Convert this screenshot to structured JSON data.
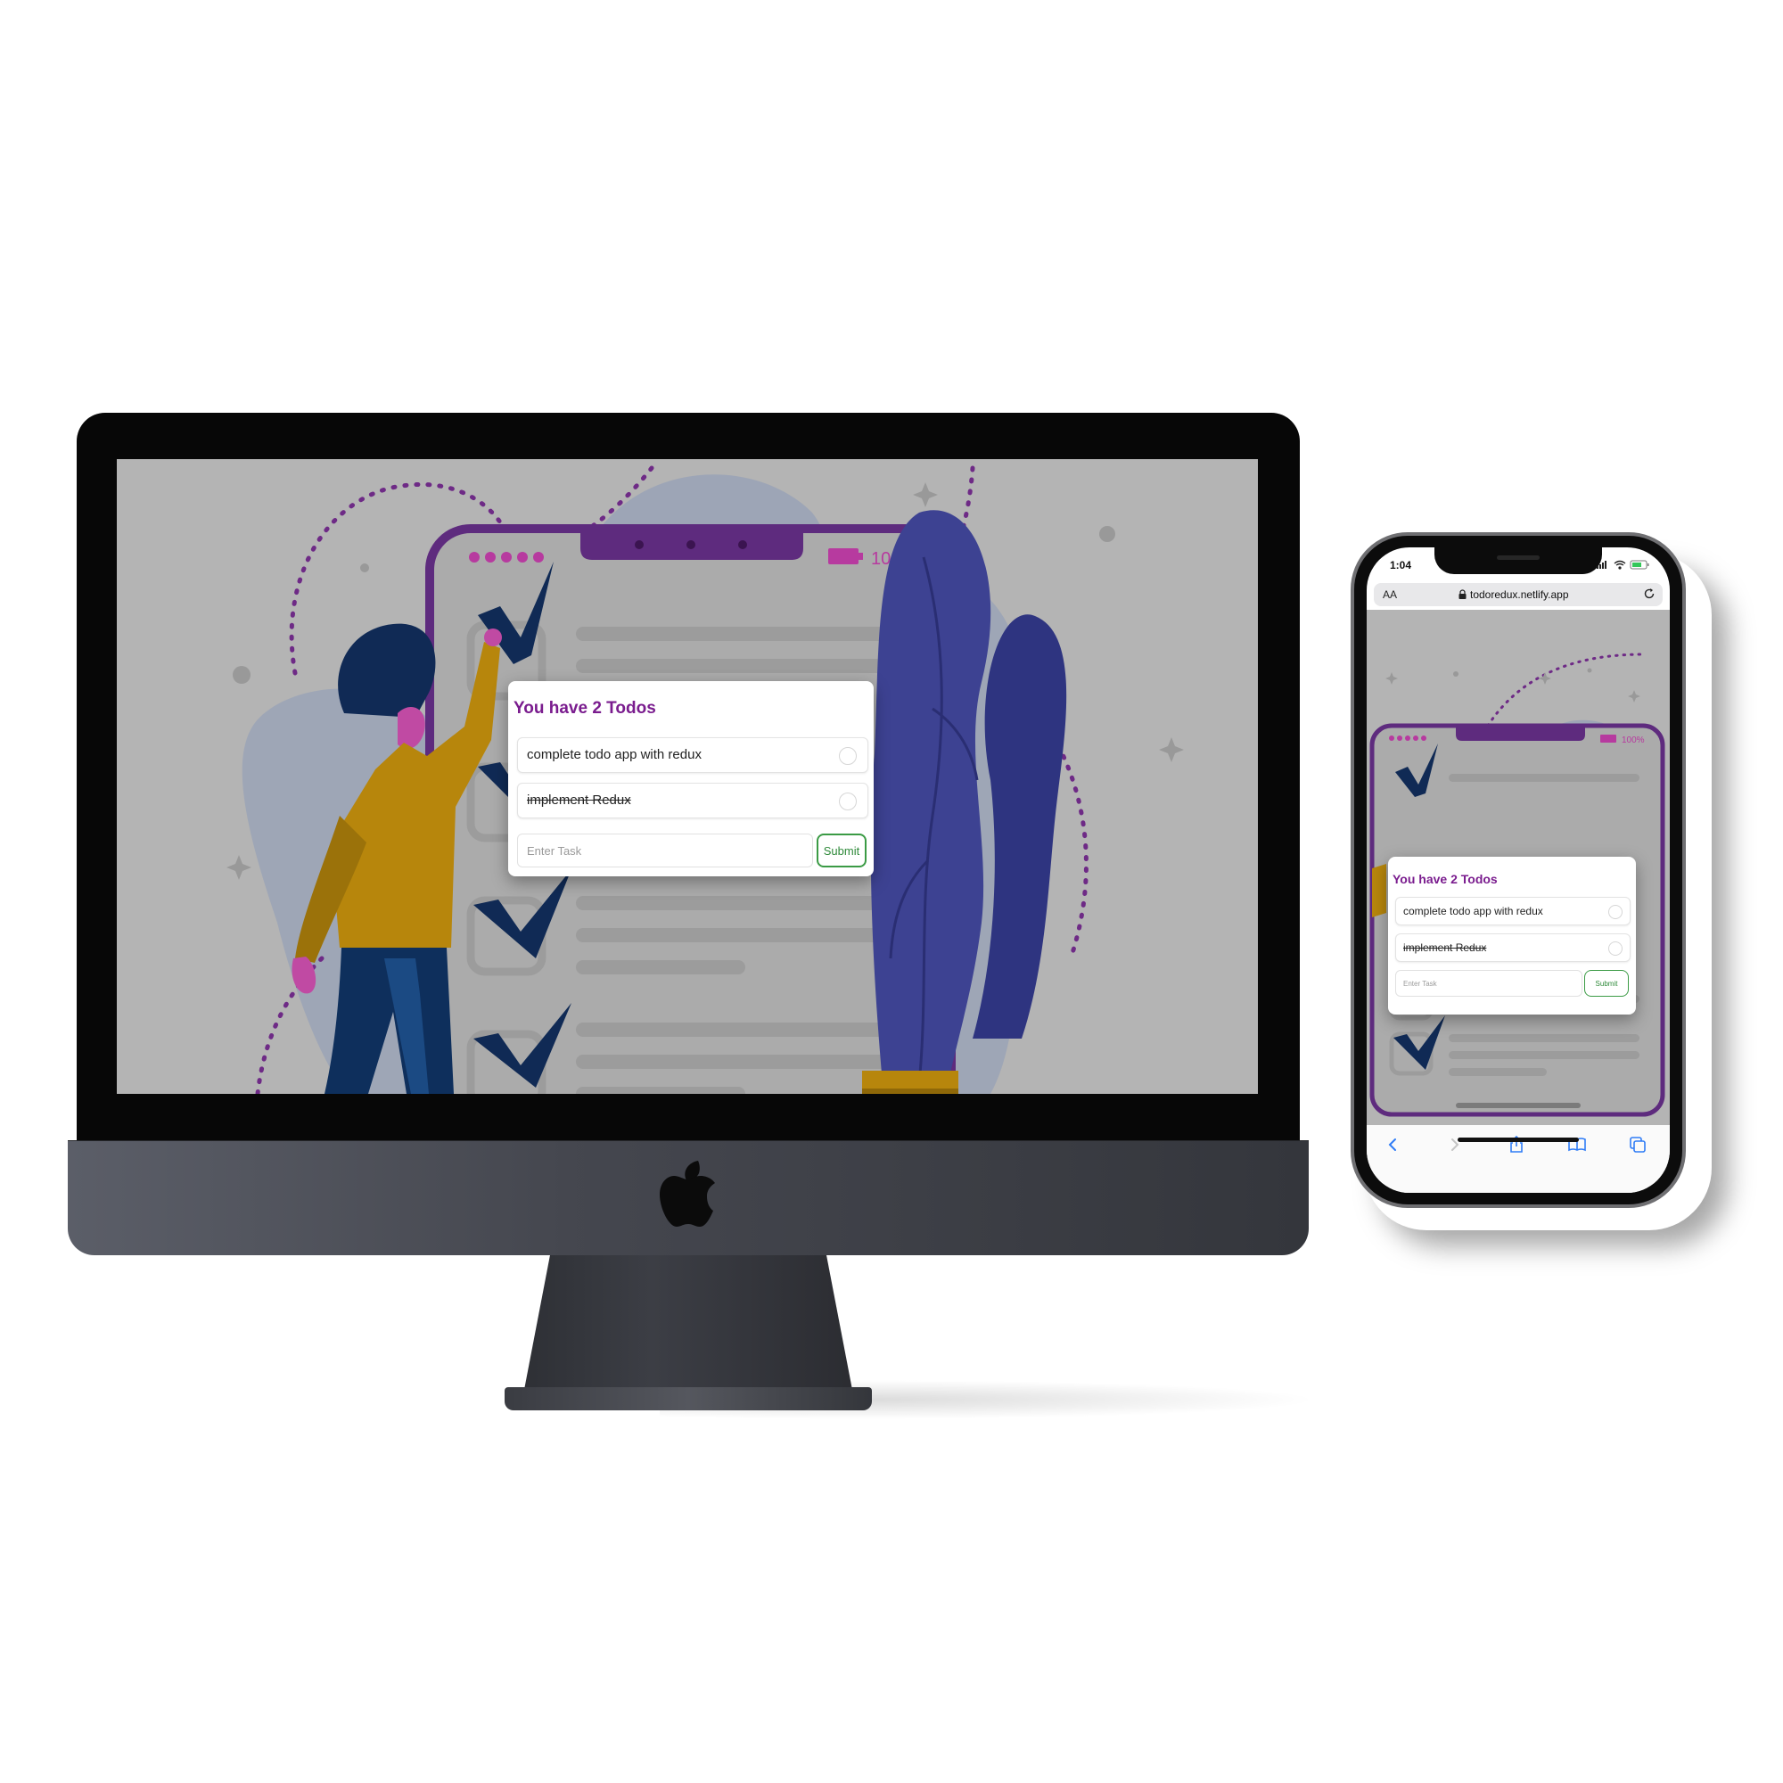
{
  "todo_app": {
    "title": "You have 2 Todos",
    "todos": [
      {
        "text": "complete todo app with redux",
        "completed": false
      },
      {
        "text": "implement Redux",
        "completed": true
      }
    ],
    "input": {
      "placeholder": "Enter Task",
      "value": ""
    },
    "submit_label": "Submit"
  },
  "illustration": {
    "battery_label": "100%"
  },
  "phone": {
    "status_time": "1:04",
    "url_aa": "AA",
    "url": "todoredux.netlify.app"
  },
  "icons": {
    "desktop": "apple-logo-icon",
    "url_bar": [
      "lock-icon",
      "reload-icon"
    ],
    "status": [
      "signal-icon",
      "wifi-icon",
      "battery-icon"
    ],
    "toolbar": [
      "back-icon",
      "forward-icon",
      "share-icon",
      "bookmarks-icon",
      "tabs-icon"
    ]
  },
  "colors": {
    "title": "#7a1c8e",
    "submit": "#3b9b45",
    "screen_bg": "#b4b4b4",
    "accent_purple": "#5e2b7e",
    "illustration_navy": "#102a55",
    "illustration_mustard": "#b7860c"
  }
}
